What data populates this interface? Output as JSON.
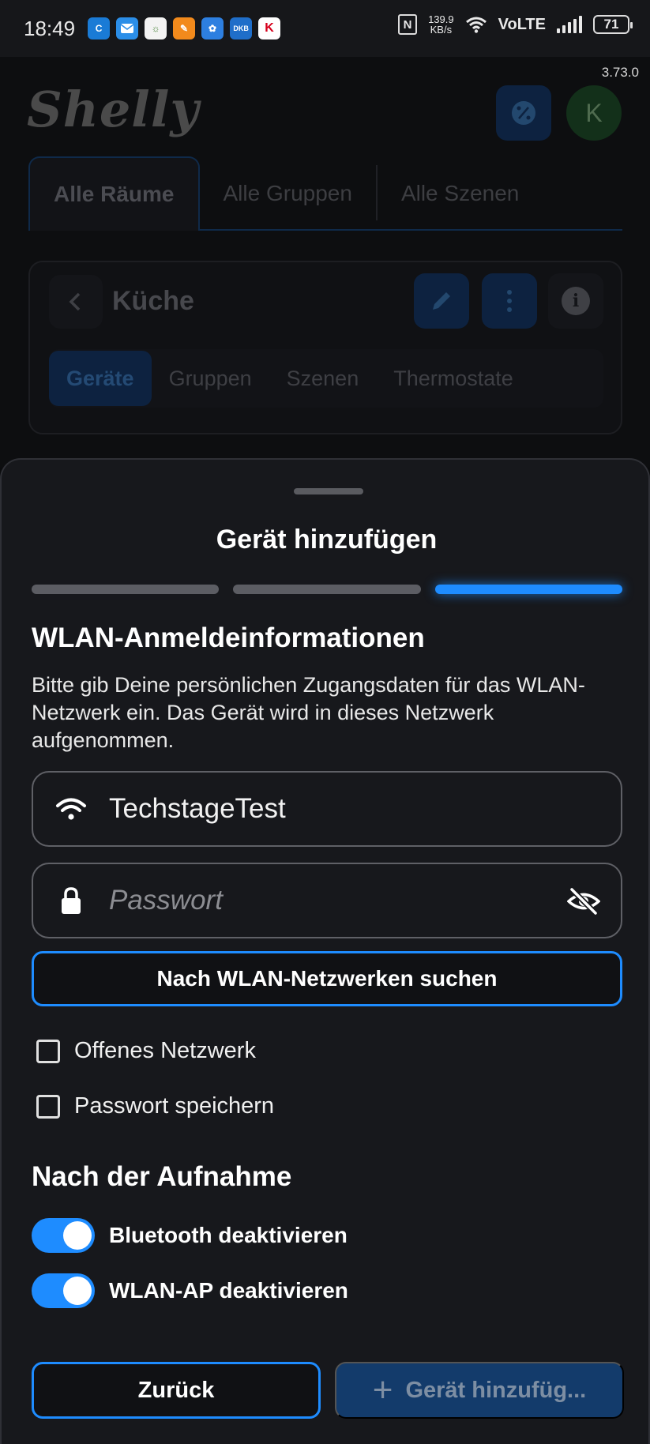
{
  "status_bar": {
    "time": "18:49",
    "speed_value": "139.9",
    "speed_unit": "KB/s",
    "network": "VoLTE",
    "battery": "71"
  },
  "app": {
    "version": "3.73.0",
    "logo_text": "Shelly",
    "avatar_initial": "K",
    "tabs": [
      {
        "label": "Alle Räume"
      },
      {
        "label": "Alle Gruppen"
      },
      {
        "label": "Alle Szenen"
      }
    ],
    "room": {
      "title": "Küche",
      "subtabs": [
        {
          "label": "Geräte"
        },
        {
          "label": "Gruppen"
        },
        {
          "label": "Szenen"
        },
        {
          "label": "Thermostate"
        }
      ]
    }
  },
  "sheet": {
    "title": "Gerät hinzufügen",
    "steps_total": 3,
    "current_step": 3,
    "wifi_section_title": "WLAN-Anmeldeinformationen",
    "wifi_description": "Bitte gib Deine persönlichen Zugangsdaten für das WLAN-Netzwerk ein. Das Gerät wird in dieses Netzwerk aufgenommen.",
    "ssid_value": "TechstageTest",
    "password_placeholder": "Passwort",
    "scan_button": "Nach WLAN-Netzwerken suchen",
    "open_network_label": "Offenes Netzwerk",
    "save_password_label": "Passwort speichern",
    "after_section_title": "Nach der Aufnahme",
    "disable_bluetooth_label": "Bluetooth deaktivieren",
    "disable_ap_label": "WLAN-AP deaktivieren",
    "back_button": "Zurück",
    "add_button": "Gerät hinzufüg..."
  }
}
